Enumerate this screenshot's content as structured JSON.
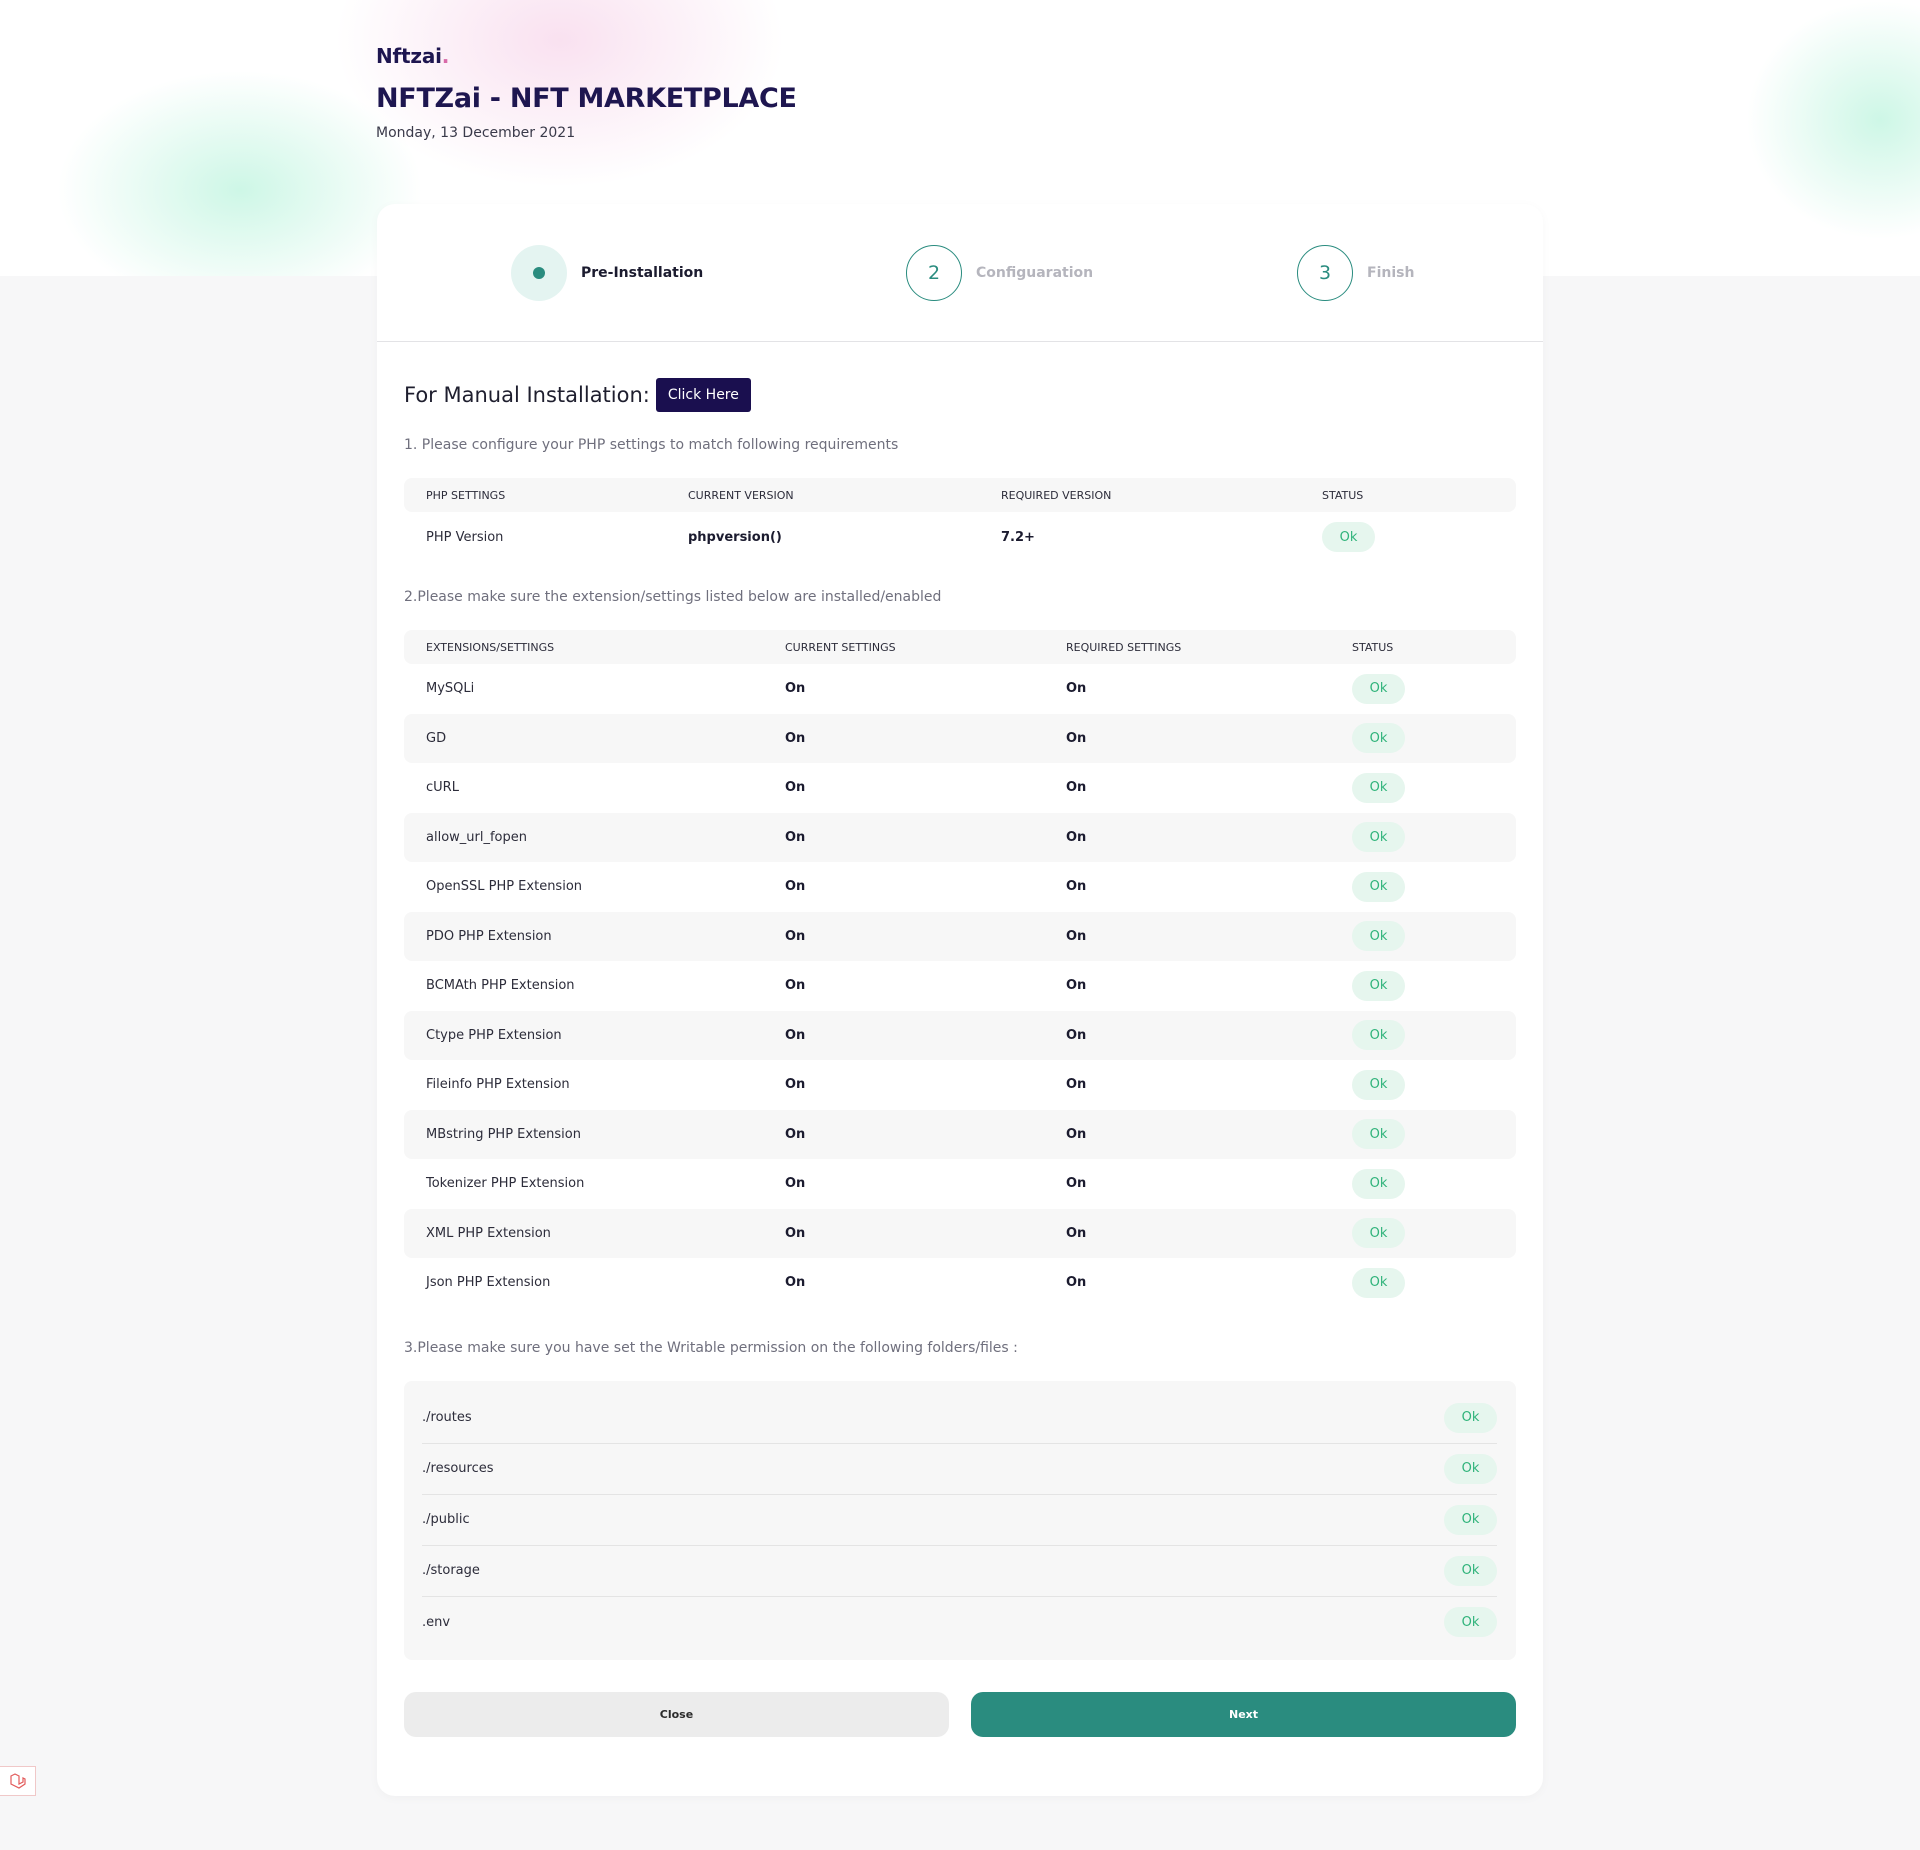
{
  "header": {
    "logo": "Nftzai",
    "logo_dot": ".",
    "title": "NFTZai - NFT MARKETPLACE",
    "date": "Monday, 13 December 2021"
  },
  "steps": [
    {
      "number": "",
      "label": "Pre-Installation",
      "active": true
    },
    {
      "number": "2",
      "label": "Configuaration",
      "active": false
    },
    {
      "number": "3",
      "label": "Finish",
      "active": false
    }
  ],
  "manual": {
    "text": "For Manual Installation:",
    "button": "Click Here"
  },
  "section1": {
    "title": "1. Please configure your PHP settings to match following requirements",
    "headers": [
      "PHP SETTINGS",
      "CURRENT VERSION",
      "REQUIRED VERSION",
      "STATUS"
    ],
    "rows": [
      {
        "name": "PHP Version",
        "current": "phpversion()",
        "required": "7.2+",
        "status": "Ok"
      }
    ]
  },
  "section2": {
    "title": "2.Please make sure the extension/settings listed below are installed/enabled",
    "headers": [
      "EXTENSIONS/SETTINGS",
      "CURRENT SETTINGS",
      "REQUIRED SETTINGS",
      "STATUS"
    ],
    "rows": [
      {
        "name": "MySQLi",
        "current": "On",
        "required": "On",
        "status": "Ok"
      },
      {
        "name": "GD",
        "current": "On",
        "required": "On",
        "status": "Ok"
      },
      {
        "name": "cURL",
        "current": "On",
        "required": "On",
        "status": "Ok"
      },
      {
        "name": "allow_url_fopen",
        "current": "On",
        "required": "On",
        "status": "Ok"
      },
      {
        "name": "OpenSSL PHP Extension",
        "current": "On",
        "required": "On",
        "status": "Ok"
      },
      {
        "name": "PDO PHP Extension",
        "current": "On",
        "required": "On",
        "status": "Ok"
      },
      {
        "name": "BCMAth PHP Extension",
        "current": "On",
        "required": "On",
        "status": "Ok"
      },
      {
        "name": "Ctype PHP Extension",
        "current": "On",
        "required": "On",
        "status": "Ok"
      },
      {
        "name": "Fileinfo PHP Extension",
        "current": "On",
        "required": "On",
        "status": "Ok"
      },
      {
        "name": "MBstring PHP Extension",
        "current": "On",
        "required": "On",
        "status": "Ok"
      },
      {
        "name": "Tokenizer PHP Extension",
        "current": "On",
        "required": "On",
        "status": "Ok"
      },
      {
        "name": "XML PHP Extension",
        "current": "On",
        "required": "On",
        "status": "Ok"
      },
      {
        "name": "Json PHP Extension",
        "current": "On",
        "required": "On",
        "status": "Ok"
      }
    ]
  },
  "section3": {
    "title": "3.Please make sure you have set the Writable permission on the following folders/files :",
    "rows": [
      {
        "path": "./routes",
        "status": "Ok"
      },
      {
        "path": "./resources",
        "status": "Ok"
      },
      {
        "path": "./public",
        "status": "Ok"
      },
      {
        "path": "./storage",
        "status": "Ok"
      },
      {
        "path": ".env",
        "status": "Ok"
      }
    ]
  },
  "actions": {
    "close": "Close",
    "next": "Next"
  },
  "colors": {
    "brand_dark": "#1e1650",
    "accent": "#2a8c7f",
    "ok_text": "#2fb37a",
    "ok_bg": "#e6f6ee"
  },
  "icons": {
    "corner": "laravel-icon"
  }
}
